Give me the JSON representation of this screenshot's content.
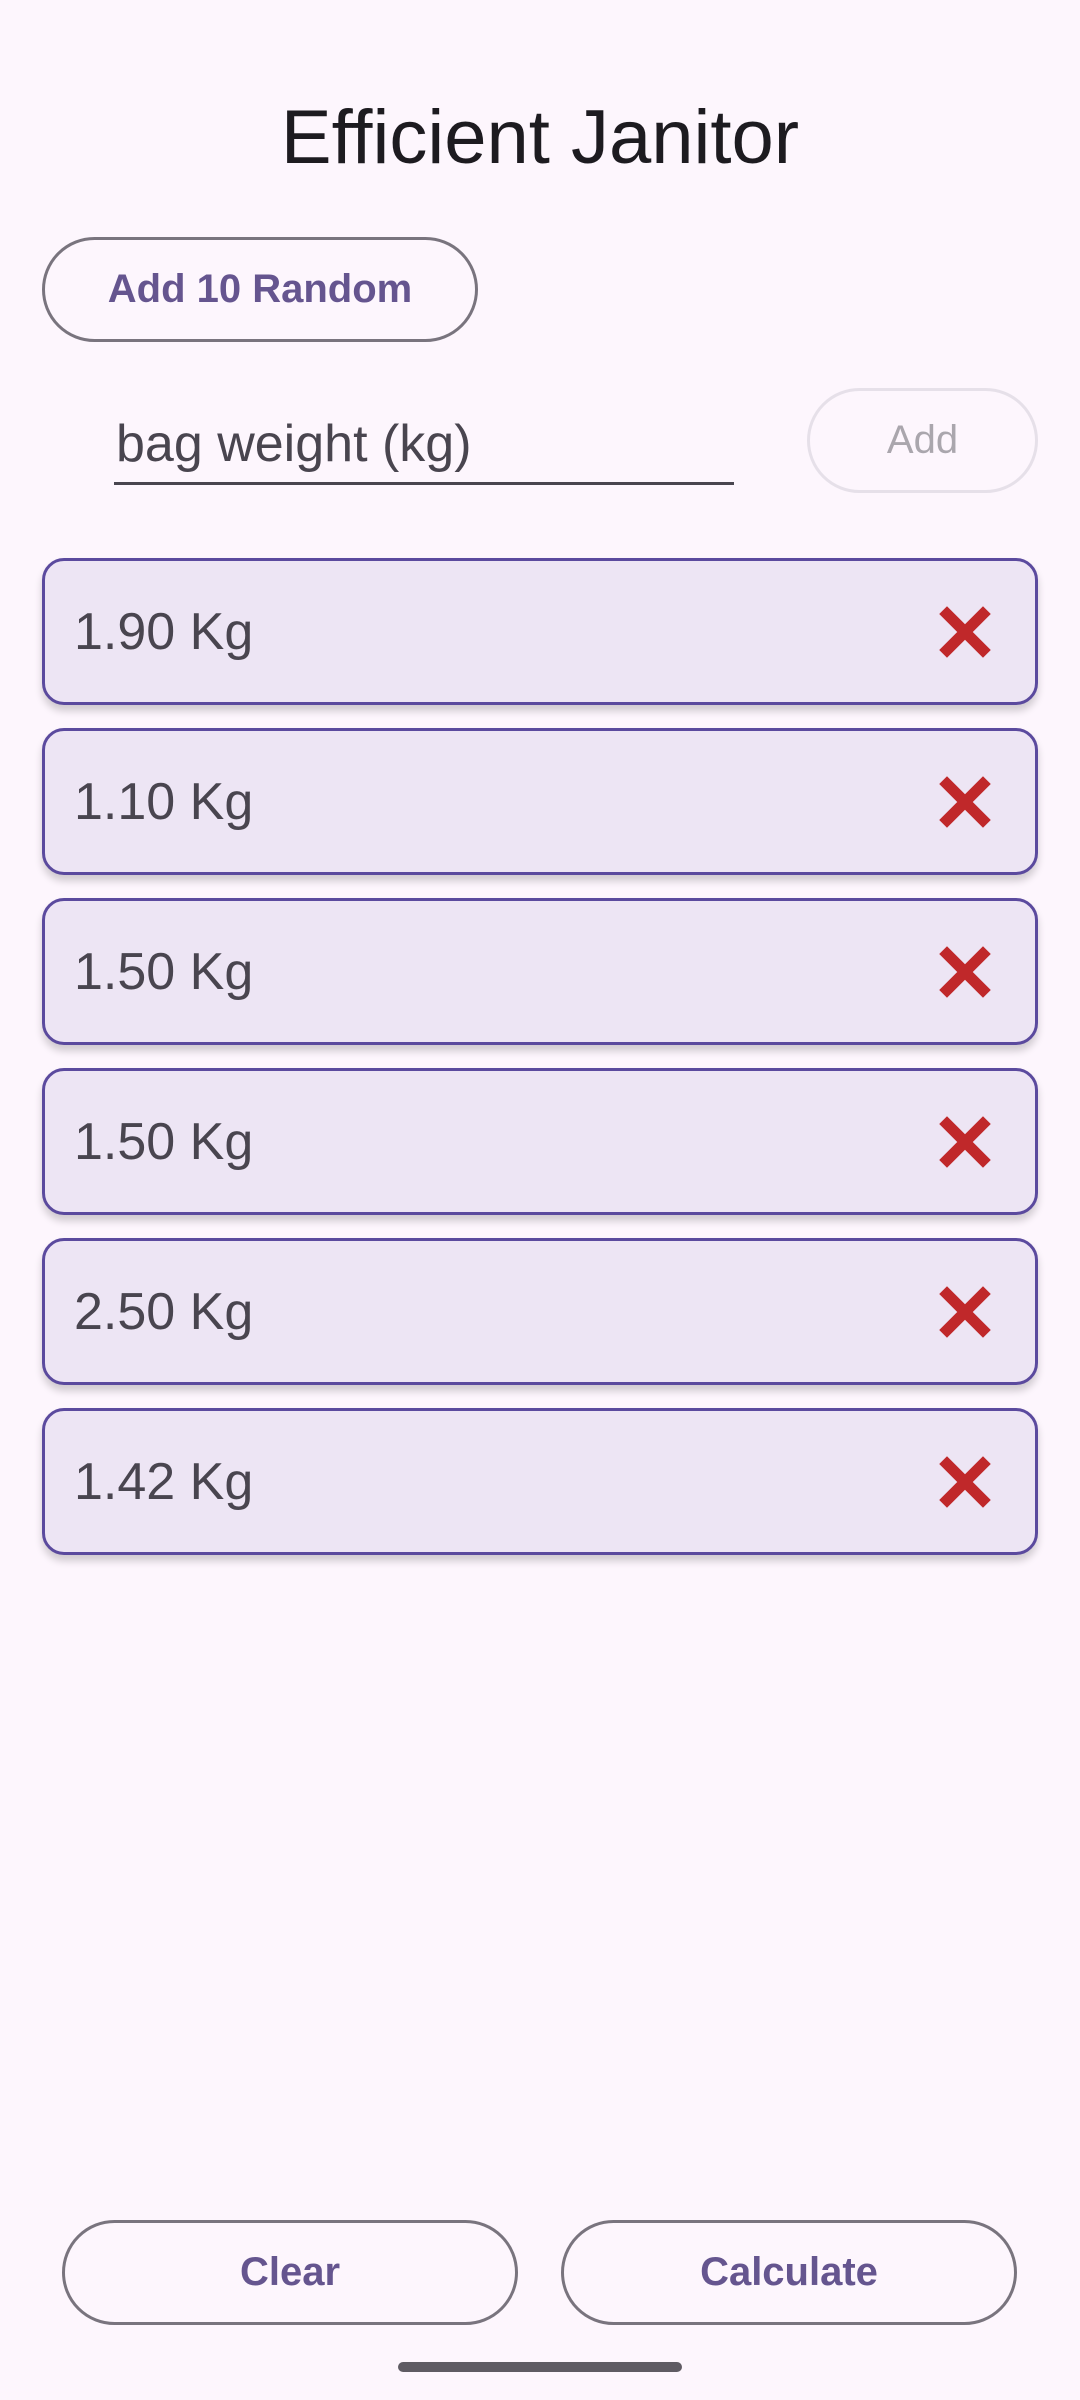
{
  "app": {
    "title": "Efficient Janitor"
  },
  "toolbar": {
    "random_label": "Add 10 Random",
    "input_placeholder": "bag weight (kg)",
    "add_label": "Add"
  },
  "bags": [
    {
      "weight": "1.90 Kg"
    },
    {
      "weight": "1.10 Kg"
    },
    {
      "weight": "1.50 Kg"
    },
    {
      "weight": "1.50 Kg"
    },
    {
      "weight": "2.50 Kg"
    },
    {
      "weight": "1.42 Kg"
    }
  ],
  "footer": {
    "clear_label": "Clear",
    "calculate_label": "Calculate"
  },
  "icons": {
    "remove": "close-icon"
  },
  "colors": {
    "background": "#fdf6fd",
    "accent": "#65558f",
    "card_border": "#5b4a9e",
    "card_fill": "#ede5f4",
    "remove_icon": "#c0282a"
  }
}
